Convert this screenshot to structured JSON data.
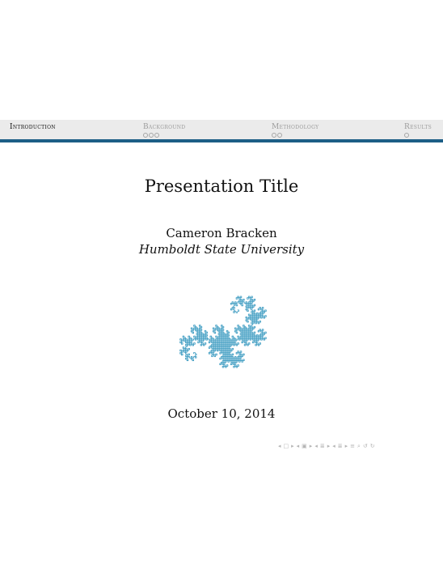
{
  "header": {
    "sections": [
      {
        "label": "Introduction",
        "dots": 0,
        "active": true
      },
      {
        "label": "Background",
        "dots": 3,
        "active": false
      },
      {
        "label": "Methodology",
        "dots": 2,
        "active": false
      },
      {
        "label": "Results",
        "dots": 1,
        "active": false
      }
    ]
  },
  "slide": {
    "title": "Presentation Title",
    "author": "Cameron Bracken",
    "institute": "Humboldt State University",
    "date": "October 10, 2014",
    "logo_color": "#3a9ac0"
  },
  "colors": {
    "nav_rule": "#1c5e86",
    "nav_background": "#ebebeb"
  },
  "navigation_controls": [
    "frame-back-icon",
    "frame-icon",
    "frame-forward-icon",
    "subsection-back-icon",
    "subsection-icon",
    "subsection-forward-icon",
    "section-back-icon",
    "section-icon",
    "section-forward-icon",
    "presentation-back-icon",
    "presentation-icon",
    "presentation-forward-icon",
    "appendix-icon",
    "search-icon",
    "undo-icon",
    "redo-icon"
  ]
}
